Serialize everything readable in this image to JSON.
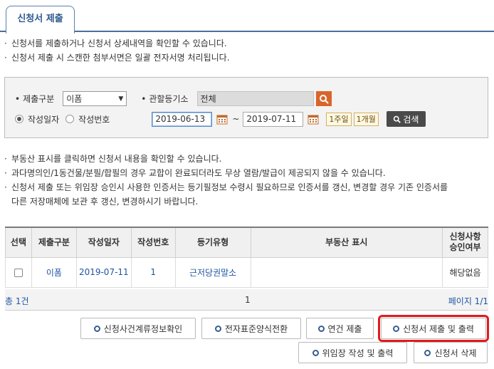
{
  "tab": {
    "label": "신청서 제출"
  },
  "intro_notes": [
    "신청서를 제출하거나 신청서 상세내역을 확인할 수 있습니다.",
    "신청서 제출 시 스캔한 첨부서면은 일괄 전자서명 처리됩니다."
  ],
  "search": {
    "type_label": "제출구분",
    "type_value": "이폼",
    "office_label": "관할등기소",
    "office_value": "전체",
    "radio_date_label": "작성일자",
    "radio_number_label": "작성번호",
    "radio_selected": "작성일자",
    "date_from": "2019-06-13",
    "date_to": "2019-07-11",
    "tilde": "~",
    "one_week": "1주일",
    "one_month": "1개월",
    "search_button": "검색"
  },
  "info_notes": [
    "부동산 표시를 클릭하면 신청서 내용을 확인할 수 있습니다.",
    "과다명의인/1동건물/분필/합필의 경우 교합이 완료되더라도 무상 열람/발급이 제공되지 않을 수 있습니다.",
    "신청서 제출 또는 위임장 승인시 사용한 인증서는 등기필정보 수령시 필요하므로 인증서를 갱신, 변경할 경우 기존 인증서를",
    "다른 저장매체에 보관 후 갱신, 변경하시기 바랍니다."
  ],
  "table": {
    "headers": {
      "select": "선택",
      "type": "제출구분",
      "date": "작성일자",
      "number": "작성번호",
      "reg_type": "등기유형",
      "property": "부동산 표시",
      "approval_line1": "신청사항",
      "approval_line2": "승인여부"
    },
    "rows": [
      {
        "type": "이폼",
        "date": "2019-07-11",
        "number": "1",
        "reg_type": "근저당권말소",
        "property": "",
        "approval": "해당없음"
      }
    ]
  },
  "pager": {
    "total": "총 1건",
    "current": "1",
    "page_info": "페이지 1/1"
  },
  "buttons": {
    "case_info": "신청사건계류정보확인",
    "e_form": "전자표준양식전환",
    "linked_submit": "연건 제출",
    "submit_print": "신청서 제출 및 출력",
    "power_of_attorney": "위임장 작성 및 출력",
    "delete": "신청서 삭제"
  },
  "colors": {
    "accent_blue": "#2e5a8e",
    "highlight_red": "#e01b1b",
    "search_orange": "#d9652a"
  }
}
